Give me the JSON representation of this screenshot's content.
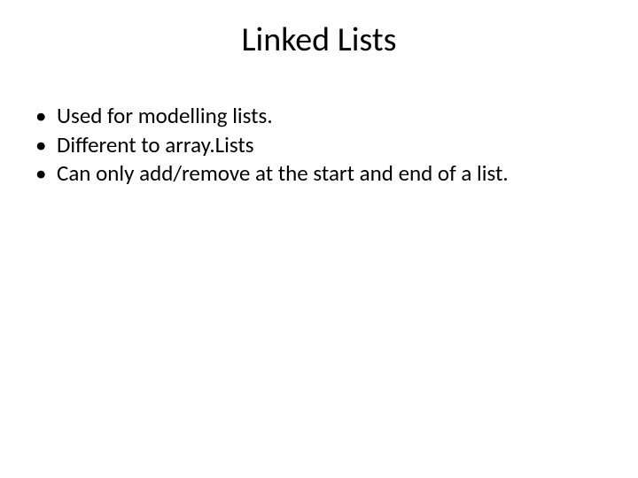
{
  "slide": {
    "title": "Linked Lists",
    "bullets": [
      "Used for modelling lists.",
      "Different to array.Lists",
      "Can only add/remove at the start and end of a list."
    ]
  }
}
